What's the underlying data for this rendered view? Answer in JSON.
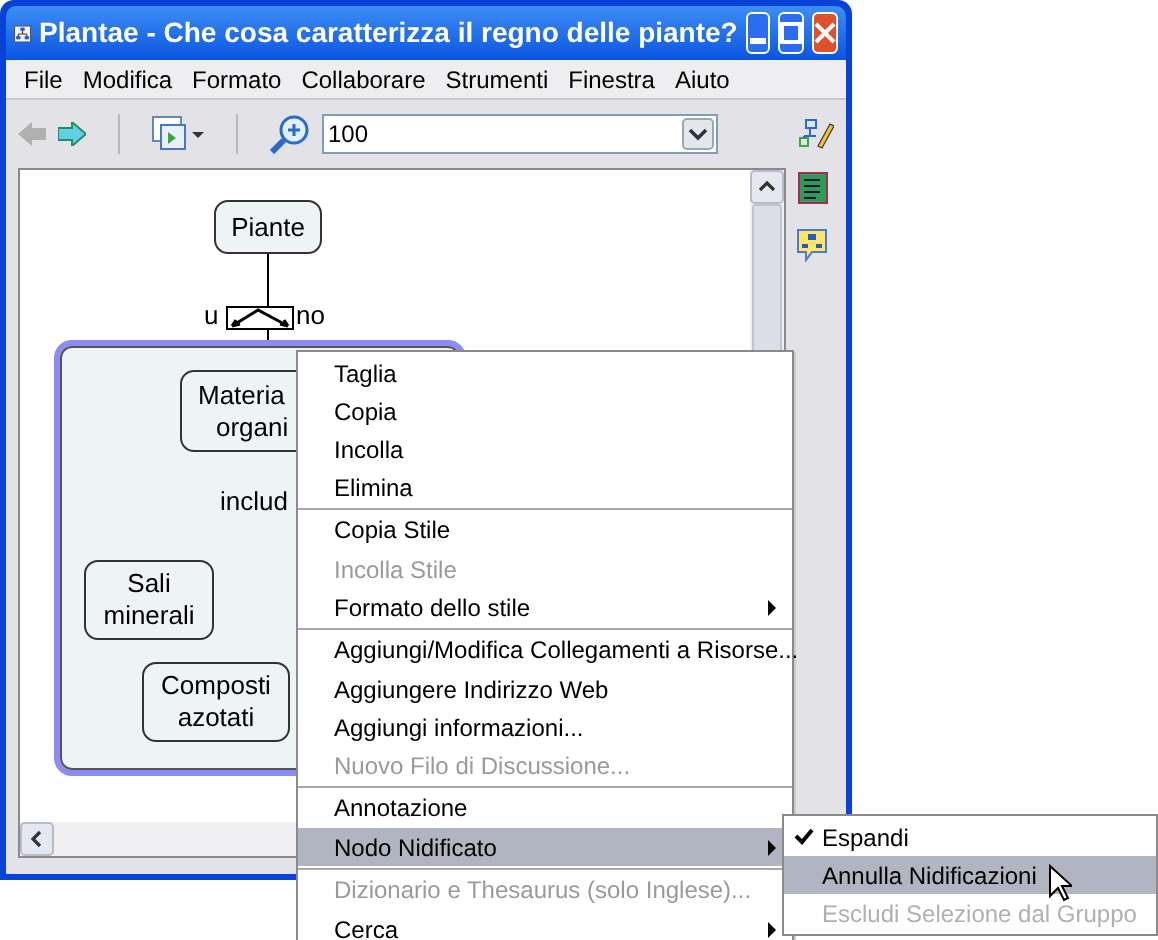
{
  "window": {
    "title": "Plantae - Che cosa caratterizza il regno delle piante?"
  },
  "menu_bar": [
    "File",
    "Modifica",
    "Formato",
    "Collaborare",
    "Strumenti",
    "Finestra",
    "Aiuto"
  ],
  "toolbar": {
    "zoom": "100"
  },
  "concept_map": {
    "top_node": "Piante",
    "link_start": "u",
    "link_end": "no",
    "group_node": [
      "Materia",
      "organi"
    ],
    "group_link": "includ",
    "child_nodes": [
      [
        "Sali",
        "minerali"
      ],
      [
        "Composti",
        "azotati"
      ]
    ]
  },
  "context_menu": [
    {
      "label": "Taglia",
      "disabled": false,
      "submenu": false,
      "selected": false,
      "separator_before": false
    },
    {
      "label": "Copia",
      "disabled": false,
      "submenu": false,
      "selected": false,
      "separator_before": false
    },
    {
      "label": "Incolla",
      "disabled": false,
      "submenu": false,
      "selected": false,
      "separator_before": false
    },
    {
      "label": "Elimina",
      "disabled": false,
      "submenu": false,
      "selected": false,
      "separator_before": false
    },
    {
      "label": "Copia Stile",
      "disabled": false,
      "submenu": false,
      "selected": false,
      "separator_before": true
    },
    {
      "label": "Incolla Stile",
      "disabled": true,
      "submenu": false,
      "selected": false,
      "separator_before": false
    },
    {
      "label": "Formato dello stile",
      "disabled": false,
      "submenu": true,
      "selected": false,
      "separator_before": false
    },
    {
      "label": "Aggiungi/Modifica Collegamenti a Risorse...",
      "disabled": false,
      "submenu": false,
      "selected": false,
      "separator_before": true
    },
    {
      "label": "Aggiungere Indirizzo Web",
      "disabled": false,
      "submenu": false,
      "selected": false,
      "separator_before": false
    },
    {
      "label": "Aggiungi informazioni...",
      "disabled": false,
      "submenu": false,
      "selected": false,
      "separator_before": false
    },
    {
      "label": "Nuovo Filo di Discussione...",
      "disabled": true,
      "submenu": false,
      "selected": false,
      "separator_before": false
    },
    {
      "label": "Annotazione",
      "disabled": false,
      "submenu": false,
      "selected": false,
      "separator_before": true
    },
    {
      "label": "Nodo Nidificato",
      "disabled": false,
      "submenu": true,
      "selected": true,
      "separator_before": false
    },
    {
      "label": "Dizionario e Thesaurus (solo Inglese)...",
      "disabled": true,
      "submenu": false,
      "selected": false,
      "separator_before": true
    },
    {
      "label": "Cerca",
      "disabled": false,
      "submenu": true,
      "selected": false,
      "separator_before": false
    }
  ],
  "submenu": [
    {
      "label": "Espandi",
      "checked": true,
      "selected": false,
      "disabled": false
    },
    {
      "label": "Annulla Nidificazioni",
      "checked": false,
      "selected": true,
      "disabled": false
    },
    {
      "label": "Escludi Selezione dal Gruppo",
      "checked": false,
      "selected": false,
      "disabled": true
    }
  ]
}
